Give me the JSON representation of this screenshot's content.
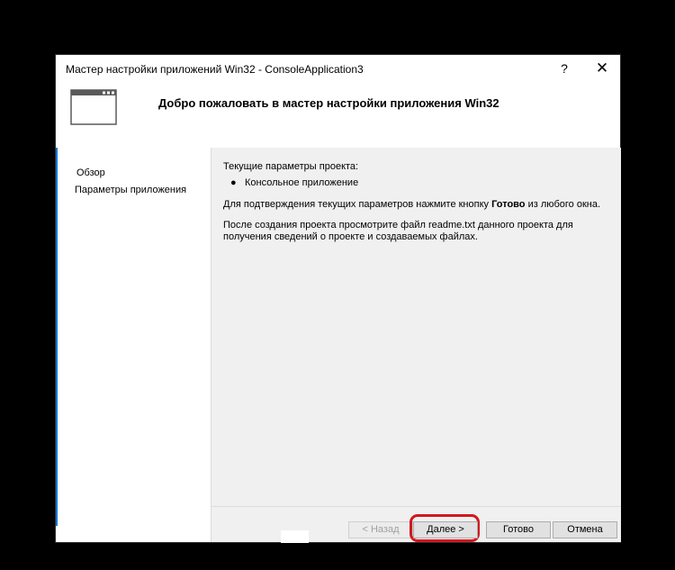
{
  "window": {
    "title": "Мастер настройки приложений Win32 - ConsoleApplication3",
    "help_glyph": "?",
    "close_glyph": "✕"
  },
  "header": {
    "title": "Добро пожаловать в мастер настройки приложения Win32",
    "icon": "window-icon"
  },
  "nav": {
    "items": [
      {
        "label": "Обзор",
        "active": true
      },
      {
        "label": "Параметры приложения",
        "active": false
      }
    ]
  },
  "content": {
    "current_params_label": "Текущие параметры проекта:",
    "bullet_glyph": "●",
    "bullet_item": "Консольное приложение",
    "confirm_text_before": "Для подтверждения текущих параметров нажмите кнопку ",
    "confirm_text_bold": "Готово",
    "confirm_text_after": " из любого окна.",
    "readme_text": "После создания проекта просмотрите файл readme.txt данного проекта для получения сведений о проекте и создаваемых файлах."
  },
  "buttons": {
    "back": "< Назад",
    "next": "Далее >",
    "finish": "Готово",
    "cancel": "Отмена"
  },
  "colors": {
    "highlight": "#d0181e",
    "accent": "#0078d7"
  }
}
